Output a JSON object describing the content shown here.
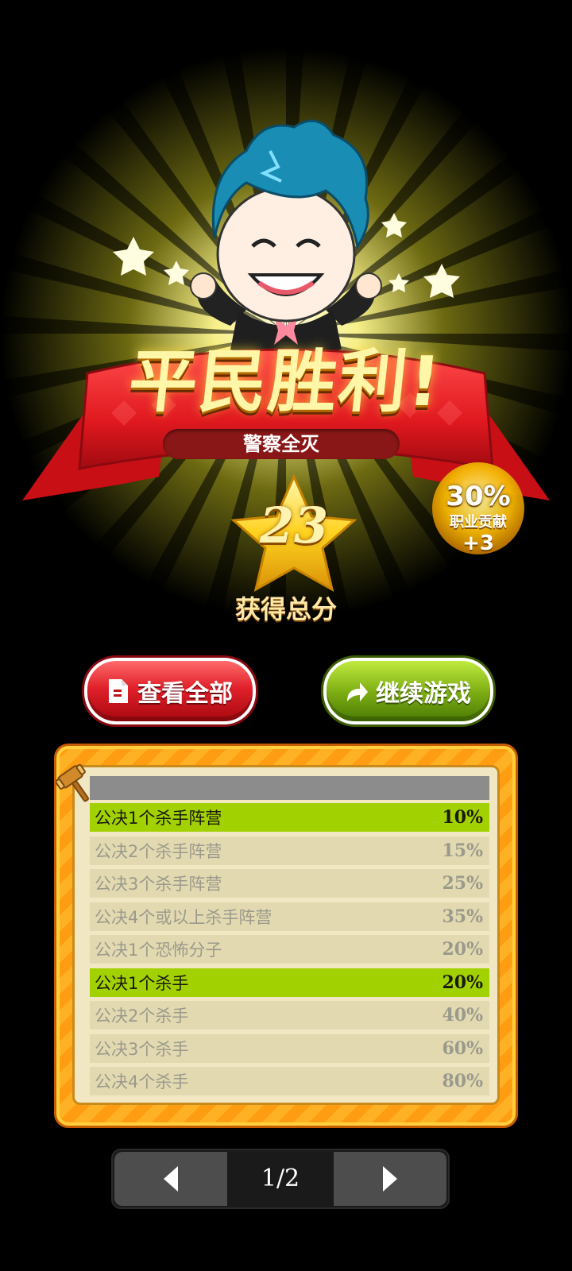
{
  "result": {
    "title": "平民胜利!",
    "subtitle": "警察全灭",
    "score": "23",
    "score_label": "获得总分",
    "bonus_percent": "30%",
    "bonus_label": "职业贡献",
    "bonus_points": "+3"
  },
  "buttons": {
    "view_all": "查看全部",
    "continue": "继续游戏"
  },
  "rules": [
    {
      "label": "公决1个杀手阵营",
      "percent": "10%",
      "active": true
    },
    {
      "label": "公决2个杀手阵营",
      "percent": "15%",
      "active": false
    },
    {
      "label": "公决3个杀手阵营",
      "percent": "25%",
      "active": false
    },
    {
      "label": "公决4个或以上杀手阵营",
      "percent": "35%",
      "active": false
    },
    {
      "label": "公决1个恐怖分子",
      "percent": "20%",
      "active": false
    },
    {
      "label": "公决1个杀手",
      "percent": "20%",
      "active": true
    },
    {
      "label": "公决2个杀手",
      "percent": "40%",
      "active": false
    },
    {
      "label": "公决3个杀手",
      "percent": "60%",
      "active": false
    },
    {
      "label": "公决4个杀手",
      "percent": "80%",
      "active": false
    }
  ],
  "pager": {
    "label": "1/2"
  },
  "colors": {
    "ribbon_red": "#e8262c",
    "active_row": "#a2d100",
    "panel_orange": "#ff9d12",
    "button_red": "#e0202a",
    "button_green": "#7fb014"
  }
}
